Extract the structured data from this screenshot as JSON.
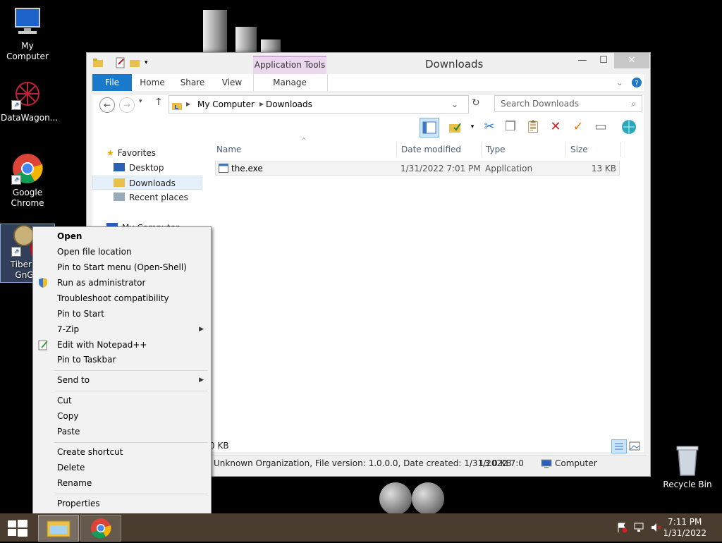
{
  "desktop": {
    "icons": [
      {
        "label": "My Computer"
      },
      {
        "label": "DataWagon..."
      },
      {
        "label": "Google Chrome"
      },
      {
        "label": "Tiberian GnGN"
      },
      {
        "label": "Recycle Bin"
      }
    ]
  },
  "explorer": {
    "title": "Downloads",
    "application_tools": "Application Tools",
    "tabs": {
      "file": "File",
      "home": "Home",
      "share": "Share",
      "view": "View",
      "manage": "Manage"
    },
    "breadcrumb": [
      "My Computer",
      "Downloads"
    ],
    "search_placeholder": "Search Downloads",
    "nav": {
      "favorites": "Favorites",
      "desktop": "Desktop",
      "downloads": "Downloads",
      "recent": "Recent places",
      "my_computer": "My Computer"
    },
    "columns": {
      "name": "Name",
      "date": "Date modified",
      "type": "Type",
      "size": "Size"
    },
    "files": [
      {
        "name": "the.exe",
        "date": "1/31/2022 7:01 PM",
        "type": "Application",
        "size": "13 KB"
      }
    ],
    "status": {
      "selection_size": "0 KB",
      "details": "Unknown Organization, File version: 1.0.0.0, Date created: 1/31/2022 7:0",
      "size": "13.0 KB",
      "location": "Computer"
    }
  },
  "context_menu": {
    "items": [
      "Open",
      "Open file location",
      "Pin to Start menu (Open-Shell)",
      "Run as administrator",
      "Troubleshoot compatibility",
      "Pin to Start",
      "7-Zip",
      "Edit with Notepad++",
      "Pin to Taskbar",
      "Send to",
      "Cut",
      "Copy",
      "Paste",
      "Create shortcut",
      "Delete",
      "Rename",
      "Properties"
    ]
  },
  "taskbar": {
    "time": "7:11 PM",
    "date": "1/31/2022"
  }
}
